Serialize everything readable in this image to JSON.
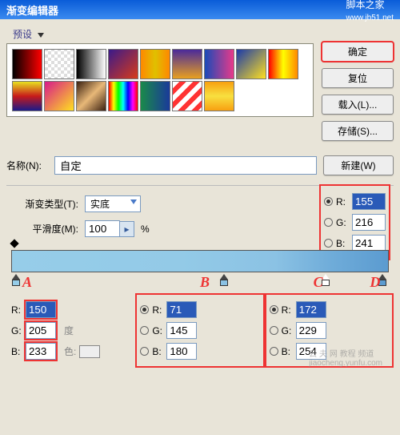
{
  "titlebar": {
    "title": "渐变编辑器",
    "site": "脚本之家",
    "url": "www.jb51.net"
  },
  "buttons": {
    "ok": "确定",
    "reset": "复位",
    "load": "载入(L)...",
    "save": "存储(S)...",
    "new": "新建(W)"
  },
  "presets": {
    "legend": "预设"
  },
  "name": {
    "label": "名称(N):",
    "value": "自定"
  },
  "type": {
    "label": "渐变类型(T):",
    "value": "实底"
  },
  "smooth": {
    "label": "平滑度(M):",
    "value": "100",
    "pct": "%"
  },
  "rgb_side": {
    "R": "155",
    "G": "216",
    "B": "241"
  },
  "stop_labels": {
    "A": "A",
    "B": "B",
    "C": "C",
    "D": "D"
  },
  "stops": {
    "A": {
      "R": "150",
      "G": "205",
      "B": "233",
      "deg": "度",
      "col": "色:"
    },
    "B": {
      "R": "71",
      "G": "145",
      "B": "180"
    },
    "C": {
      "R": "172",
      "G": "229",
      "B": "254"
    }
  },
  "rgb_labels": {
    "R": "R:",
    "G": "G:",
    "B": "B:"
  },
  "watermark": {
    "line1": "云 夫 网 教程 频道",
    "line2": "jiaocheng.yunfu.com"
  }
}
